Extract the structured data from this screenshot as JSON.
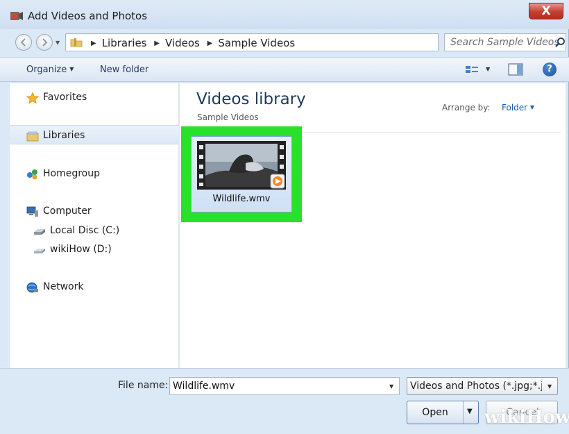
{
  "window": {
    "title": "Add Videos and Photos",
    "close_glyph": "X"
  },
  "address": {
    "crumbs": [
      "Libraries",
      "Videos",
      "Sample Videos"
    ],
    "search_placeholder": "Search Sample Videos"
  },
  "toolbar": {
    "organize_label": "Organize",
    "new_folder_label": "New folder",
    "help_glyph": "?"
  },
  "sidebar": {
    "favorites": "Favorites",
    "libraries": "Libraries",
    "homegroup": "Homegroup",
    "computer": "Computer",
    "local_disc": "Local Disc (C:)",
    "wikihow_drive": "wikiHow (D:)",
    "network": "Network",
    "selected": "Libraries"
  },
  "content": {
    "title": "Videos library",
    "subtitle": "Sample Videos",
    "arrange_label": "Arrange by:",
    "arrange_value": "Folder",
    "files": [
      {
        "name": "Wildlife.wmv",
        "highlighted": true
      }
    ],
    "highlight_color": "#29e02a"
  },
  "footer": {
    "file_name_label": "File name:",
    "file_name_value": "Wildlife.wmv",
    "filter_value": "Videos and Photos (*.jpg;*.j",
    "open_label": "Open",
    "cancel_label": "Cancel"
  },
  "watermark": {
    "part1": "wiki",
    "part2": "How"
  }
}
